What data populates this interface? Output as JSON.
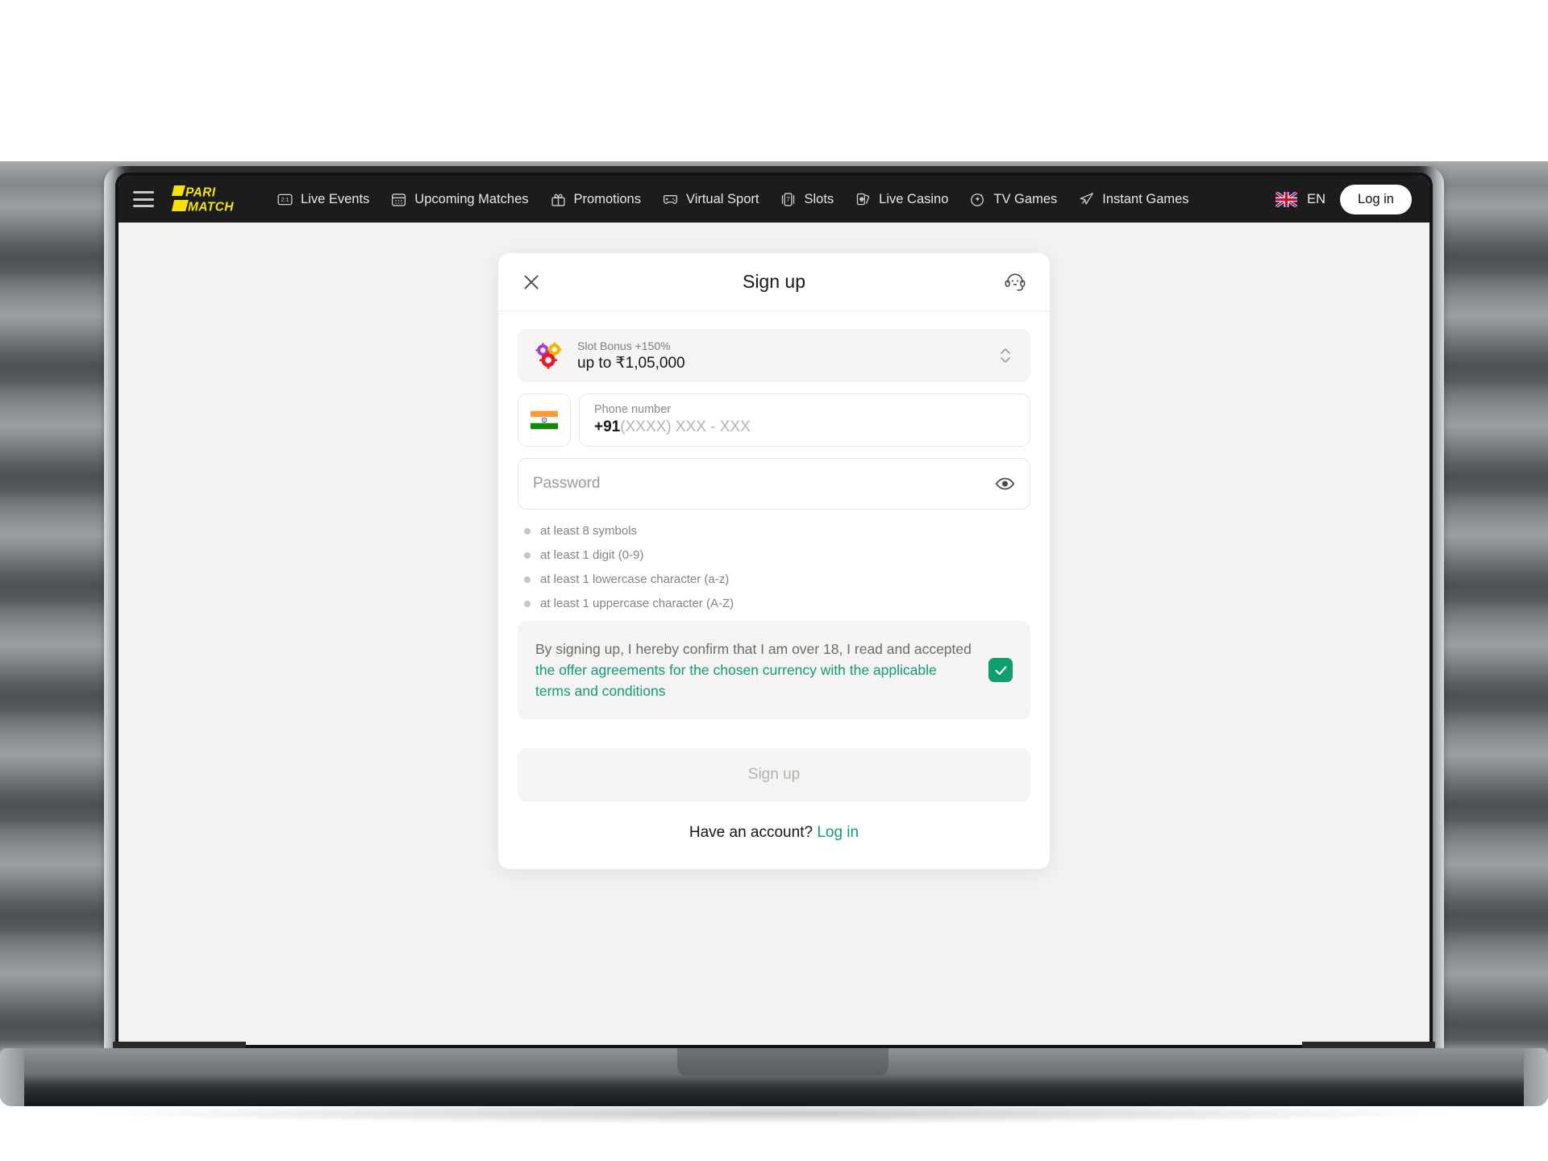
{
  "nav": {
    "menu_icon": "hamburger-icon",
    "logo": {
      "line1": "PARI",
      "line2": "MATCH"
    },
    "items": [
      {
        "label": "Live Events",
        "icon": "scoreboard-icon"
      },
      {
        "label": "Upcoming Matches",
        "icon": "calendar-icon"
      },
      {
        "label": "Promotions",
        "icon": "gift-icon"
      },
      {
        "label": "Virtual Sport",
        "icon": "gamepad-icon"
      },
      {
        "label": "Slots",
        "icon": "slot-card-icon"
      },
      {
        "label": "Live Casino",
        "icon": "playing-cards-icon"
      },
      {
        "label": "TV Games",
        "icon": "sparkle-icon"
      },
      {
        "label": "Instant Games",
        "icon": "rocket-icon"
      }
    ],
    "language": {
      "code": "EN",
      "flag": "uk-flag-icon"
    },
    "login_label": "Log in"
  },
  "modal": {
    "title": "Sign up",
    "close_icon": "close-icon",
    "support_icon": "support-headset-icon",
    "bonus": {
      "icon": "casino-chips-icon",
      "subtitle": "Slot Bonus +150%",
      "amount": "up to ₹1,05,000",
      "stepper_icon": "chevron-up-down-icon"
    },
    "phone": {
      "country_flag": "india-flag-icon",
      "label": "Phone number",
      "country_code": "+91",
      "mask": "(XXXX) XXX - XXX"
    },
    "password": {
      "placeholder": "Password",
      "toggle_icon": "eye-icon"
    },
    "password_rules": [
      "at least 8 symbols",
      "at least 1 digit (0-9)",
      "at least 1 lowercase character (a-z)",
      "at least 1 uppercase character (A-Z)"
    ],
    "terms": {
      "text_before": "By signing up, I hereby confirm that I am over 18, I read and accepted ",
      "link_text": "the offer agreements for the chosen currency with the applicable terms and conditions",
      "checked": true,
      "check_icon": "checkmark-icon"
    },
    "submit_label": "Sign up",
    "footer": {
      "question": "Have an account? ",
      "link": "Log in"
    }
  },
  "colors": {
    "nav_bg": "#1c1c1c",
    "brand_yellow": "#f5e400",
    "accent_green": "#0f9f6e",
    "page_bg": "#f3f2f0",
    "modal_bg": "#ffffff",
    "field_bg": "#f5f4f2"
  }
}
